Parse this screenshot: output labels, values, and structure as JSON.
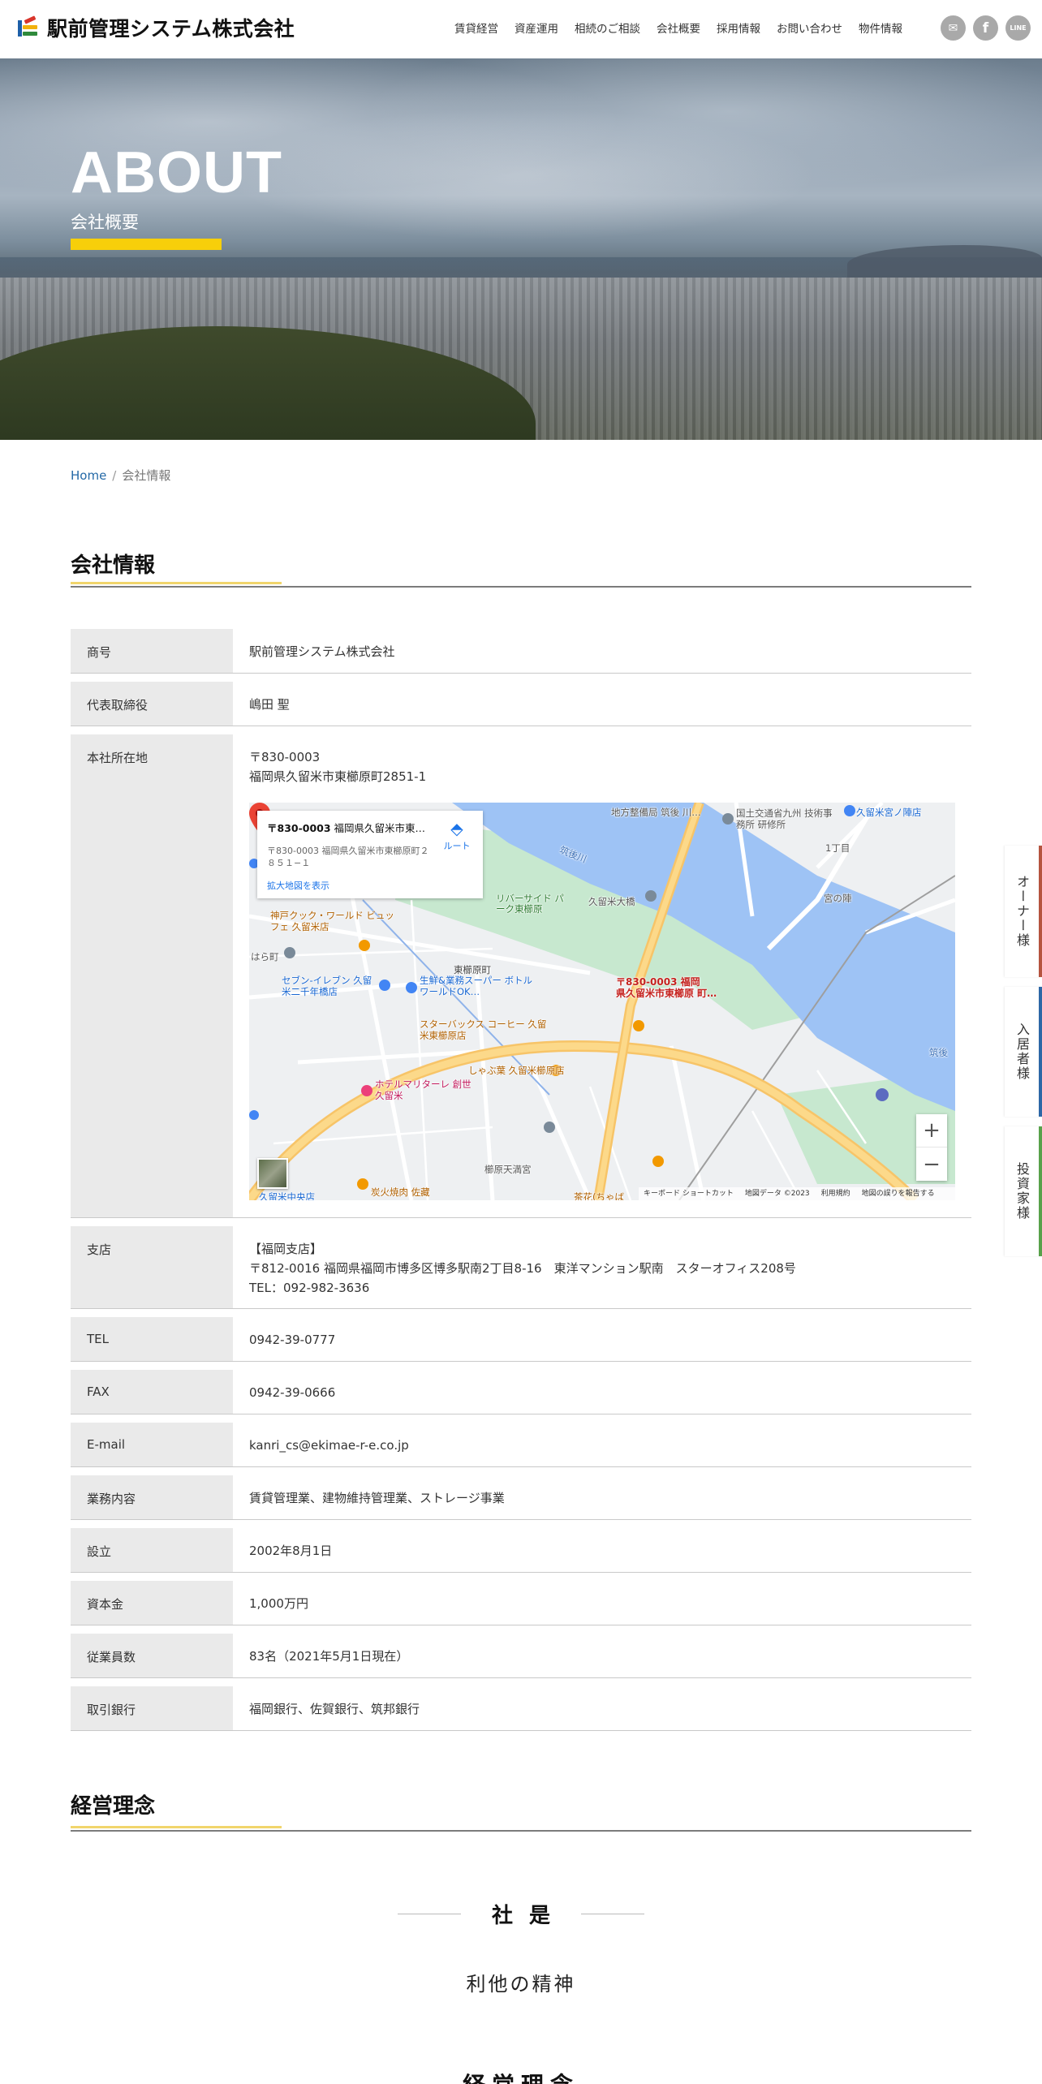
{
  "header": {
    "logo_text": "駅前管理システム株式会社",
    "nav": [
      "賃貸経営",
      "資産運用",
      "相続のご相談",
      "会社概要",
      "採用情報",
      "お問い合わせ",
      "物件情報"
    ],
    "social": [
      {
        "icon": "mail-icon",
        "glyph": "✉"
      },
      {
        "icon": "facebook-icon",
        "glyph": "f"
      },
      {
        "icon": "line-icon",
        "glyph": "LINE"
      }
    ]
  },
  "hero": {
    "title": "ABOUT",
    "subtitle": "会社概要",
    "accent_color": "#f7cf0a"
  },
  "breadcrumb": {
    "home": "Home",
    "separator": "/",
    "current": "会社情報"
  },
  "company": {
    "heading": "会社情報",
    "rows": [
      {
        "label": "商号",
        "value": "駅前管理システム株式会社"
      },
      {
        "label": "代表取締役",
        "value": "嶋田 聖"
      },
      {
        "label": "本社所在地",
        "lines": [
          "〒830-0003",
          "福岡県久留米市東櫛原町2851-1"
        ]
      },
      {
        "label": "支店",
        "lines": [
          "【福岡支店】",
          "〒812-0016 福岡県福岡市博多区博多駅南2丁目8-16　東洋マンション駅南　スターオフィス208号",
          "TEL：092-982-3636"
        ]
      },
      {
        "label": "TEL",
        "value": "0942-39-0777"
      },
      {
        "label": "FAX",
        "value": "0942-39-0666"
      },
      {
        "label": "E-mail",
        "value": "kanri_cs@ekimae-r-e.co.jp"
      },
      {
        "label": "業務内容",
        "value": "賃貸管理業、建物維持管理業、ストレージ事業"
      },
      {
        "label": "設立",
        "value": "2002年8月1日"
      },
      {
        "label": "資本金",
        "value": "1,000万円"
      },
      {
        "label": "従業員数",
        "value": "83名（2021年5月1日現在）"
      },
      {
        "label": "取引銀行",
        "value": "福岡銀行、佐賀銀行、筑邦銀行"
      }
    ]
  },
  "map": {
    "card_title_bold": "〒830-0003",
    "card_title_rest": " 福岡県久留米市東…",
    "card_address": "〒830-0003 福岡県久留米市東櫛原町２８５１−１",
    "card_link": "拡大地図を表示",
    "route_label": "ルート",
    "pin_label_1": "〒830-0003 福岡",
    "pin_label_2": "県久留米市東櫛原 町…",
    "zoom_in": "+",
    "zoom_out": "−",
    "footer": [
      "キーボード ショートカット",
      "地図データ ©2023",
      "利用規約",
      "地図の誤りを報告する"
    ],
    "labels": [
      {
        "text": "筑後川",
        "color": "#3b6fb6"
      },
      {
        "text": "久留米大橋",
        "color": "#555"
      },
      {
        "text": "リバーサイド パーク東櫛原",
        "color": "#2e7d32"
      },
      {
        "text": "東櫛原町",
        "color": "#444"
      },
      {
        "text": "神戸クック・ワールド ビュッフェ 久留米店",
        "color": "#b06000"
      },
      {
        "text": "セブン-イレブン 久留米二千年橋店",
        "color": "#1967d2"
      },
      {
        "text": "生鮮&業務スーパー ボトルワールドOK…",
        "color": "#1967d2"
      },
      {
        "text": "スターバックス コーヒー 久留米東櫛原店",
        "color": "#b06000"
      },
      {
        "text": "しゃぶ葉 久留米櫛原店",
        "color": "#b06000"
      },
      {
        "text": "ホテルマリターレ 創世 久留米",
        "color": "#c2185b"
      },
      {
        "text": "櫛原天満宮",
        "color": "#555"
      },
      {
        "text": "炭火焼肉 佐藏",
        "color": "#b06000"
      },
      {
        "text": "国土交通省九州 技術事務所 研修所",
        "color": "#555"
      },
      {
        "text": "久留米宮ノ陣店",
        "color": "#1967d2"
      },
      {
        "text": "宮の陣",
        "color": "#555"
      },
      {
        "text": "1丁目",
        "color": "#555"
      },
      {
        "text": "筑後",
        "color": "#3b6fb6"
      },
      {
        "text": "地方整備局 筑後 川…",
        "color": "#555"
      },
      {
        "text": "久留米中央店",
        "color": "#1967d2"
      },
      {
        "text": "茶花(ちゃば",
        "color": "#b06000"
      },
      {
        "text": "はら町",
        "color": "#555"
      }
    ]
  },
  "side_tabs": [
    {
      "label": "オーナー様",
      "color": "#b5543f"
    },
    {
      "label": "入居者様",
      "color": "#2d67a6"
    },
    {
      "label": "投資家様",
      "color": "#58a14a"
    }
  ],
  "philosophy": {
    "heading": "経営理念",
    "motto_label": "社是",
    "motto": "利他の精神",
    "next_heading": "経営理念"
  }
}
